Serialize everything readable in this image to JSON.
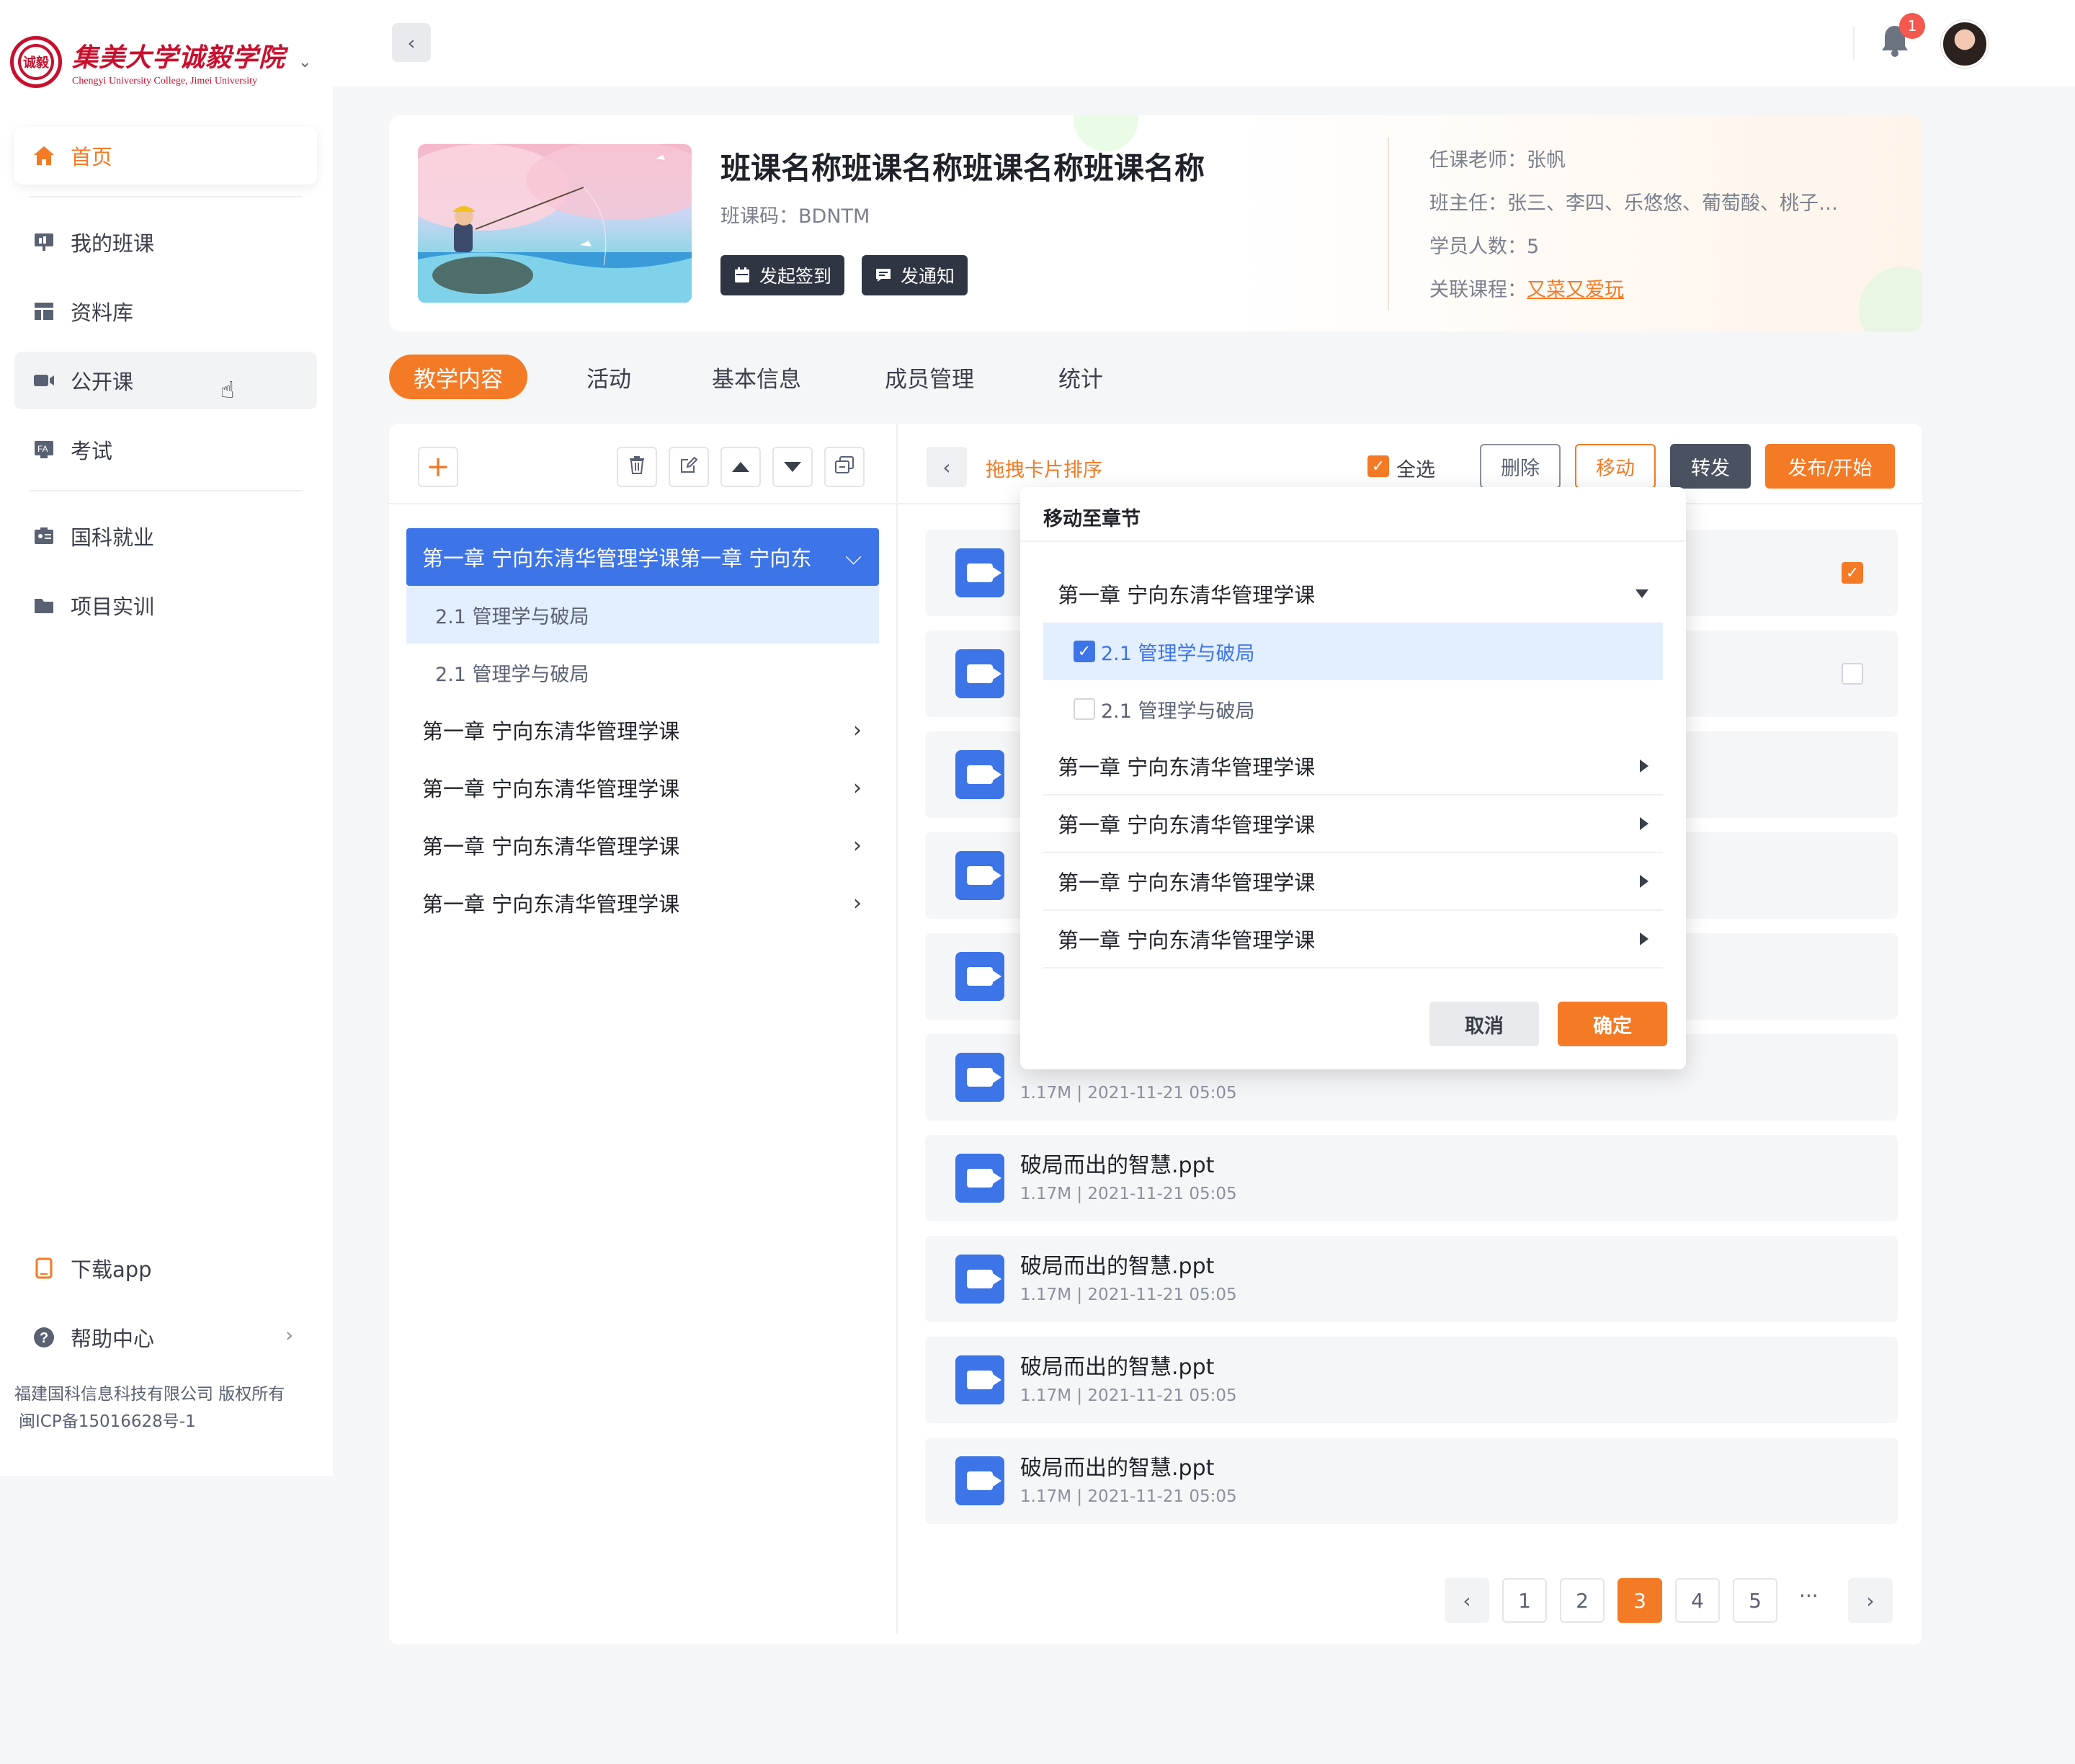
{
  "sidebar": {
    "logo_cn": "集美大学诚毅学院",
    "logo_en": "Chengyi University College, Jimei University",
    "logo_seal": "诚毅",
    "items": [
      {
        "label": "首页",
        "icon": "home-icon"
      },
      {
        "label": "我的班课",
        "icon": "presentation-icon"
      },
      {
        "label": "资料库",
        "icon": "layout-icon"
      },
      {
        "label": "公开课",
        "icon": "video-icon"
      },
      {
        "label": "考试",
        "icon": "exam-icon"
      },
      {
        "label": "国科就业",
        "icon": "badge-icon"
      },
      {
        "label": "项目实训",
        "icon": "folder-icon"
      }
    ],
    "download_app": "下载app",
    "help_center": "帮助中心",
    "copyright_line1": "福建国科信息科技有限公司 版权所有",
    "copyright_line2": "闽ICP备15016628号-1"
  },
  "topbar": {
    "notification_count": "1"
  },
  "course": {
    "title": "班课名称班课名称班课名称班课名称",
    "code_label": "班课码：BDNTM",
    "checkin_button": "发起签到",
    "notice_button": "发通知",
    "teacher": "任课老师：张帆",
    "head_teacher": "班主任：张三、李四、乐悠悠、葡萄酸、桃子…",
    "student_count": "学员人数：5",
    "related_label": "关联课程：",
    "related_link": "又菜又爱玩"
  },
  "tabs": [
    "教学内容",
    "活动",
    "基本信息",
    "成员管理",
    "统计"
  ],
  "tree": {
    "open_chapter": "第一章  宁向东清华管理学课第一章  宁向东",
    "subs": [
      "2.1  管理学与破局",
      "2.1  管理学与破局"
    ],
    "chapters": [
      "第一章  宁向东清华管理学课",
      "第一章  宁向东清华管理学课",
      "第一章  宁向东清华管理学课",
      "第一章  宁向东清华管理学课"
    ]
  },
  "toolbar": {
    "drag_sort": "拖拽卡片排序",
    "select_all": "全选",
    "delete": "删除",
    "move": "移动",
    "forward": "转发",
    "publish": "发布/开始"
  },
  "files": [
    {
      "name": "破局而出的智慧.ppt",
      "meta": "1.17M |   2021-11-21 05:05"
    },
    {
      "name": "破局而出的智慧.ppt",
      "meta": "1.17M |   2021-11-21 05:05"
    },
    {
      "name": "破局而出的智慧.ppt",
      "meta": "1.17M |   2021-11-21 05:05"
    },
    {
      "name": "破局而出的智慧.ppt",
      "meta": "1.17M |   2021-11-21 05:05"
    },
    {
      "name": "破局而出的智慧.ppt",
      "meta": "1.17M |   2021-11-21 05:05"
    }
  ],
  "pagination": {
    "pages": [
      "1",
      "2",
      "3",
      "4",
      "5"
    ],
    "current": "3",
    "ellipsis": "···"
  },
  "dialog": {
    "title": "移动至章节",
    "open_chapter": "第一章  宁向东清华管理学课",
    "subs": [
      "2.1  管理学与破局",
      "2.1  管理学与破局"
    ],
    "chapters": [
      "第一章  宁向东清华管理学课",
      "第一章  宁向东清华管理学课",
      "第一章  宁向东清华管理学课",
      "第一章  宁向东清华管理学课"
    ],
    "cancel": "取消",
    "confirm": "确定"
  },
  "colors": {
    "accent": "#f47a26",
    "primary_blue": "#3d74e8",
    "dark_button": "#2f3542"
  }
}
